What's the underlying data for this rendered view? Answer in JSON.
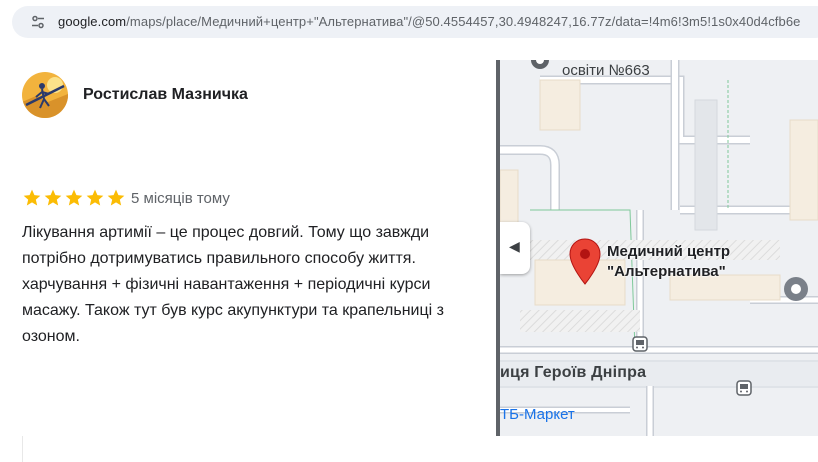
{
  "browser": {
    "url_domain": "google.com",
    "url_path": "/maps/place/Медичний+центр+\"Альтернатива\"/@50.4554457,30.4948247,16.77z/data=!4m6!3m5!1s0x40d4cfb6e"
  },
  "review": {
    "reviewer_name": "Ростислав Мазничка",
    "rating": 5,
    "rating_max": 5,
    "date": "5 місяців тому",
    "text": "Лікування артимії – це процес довгий. Тому що завжди потрібно дотримуватись правильного способу життя. харчування + фізичні навантаження + періодичні курси масажу. Також тут був курс акупунктури та крапельниці з озоном."
  },
  "map": {
    "school_label": "освіти №663",
    "poi_title_line1": "Медичний центр",
    "poi_title_line2": "\"Альтернатива\"",
    "street_label": "иця Героїв Дніпра",
    "store_label": "ТБ-Маркет",
    "collapse_glyph": "◀"
  },
  "colors": {
    "star": "#fbbc04",
    "pin": "#ea4335",
    "link": "#1a73e8"
  }
}
